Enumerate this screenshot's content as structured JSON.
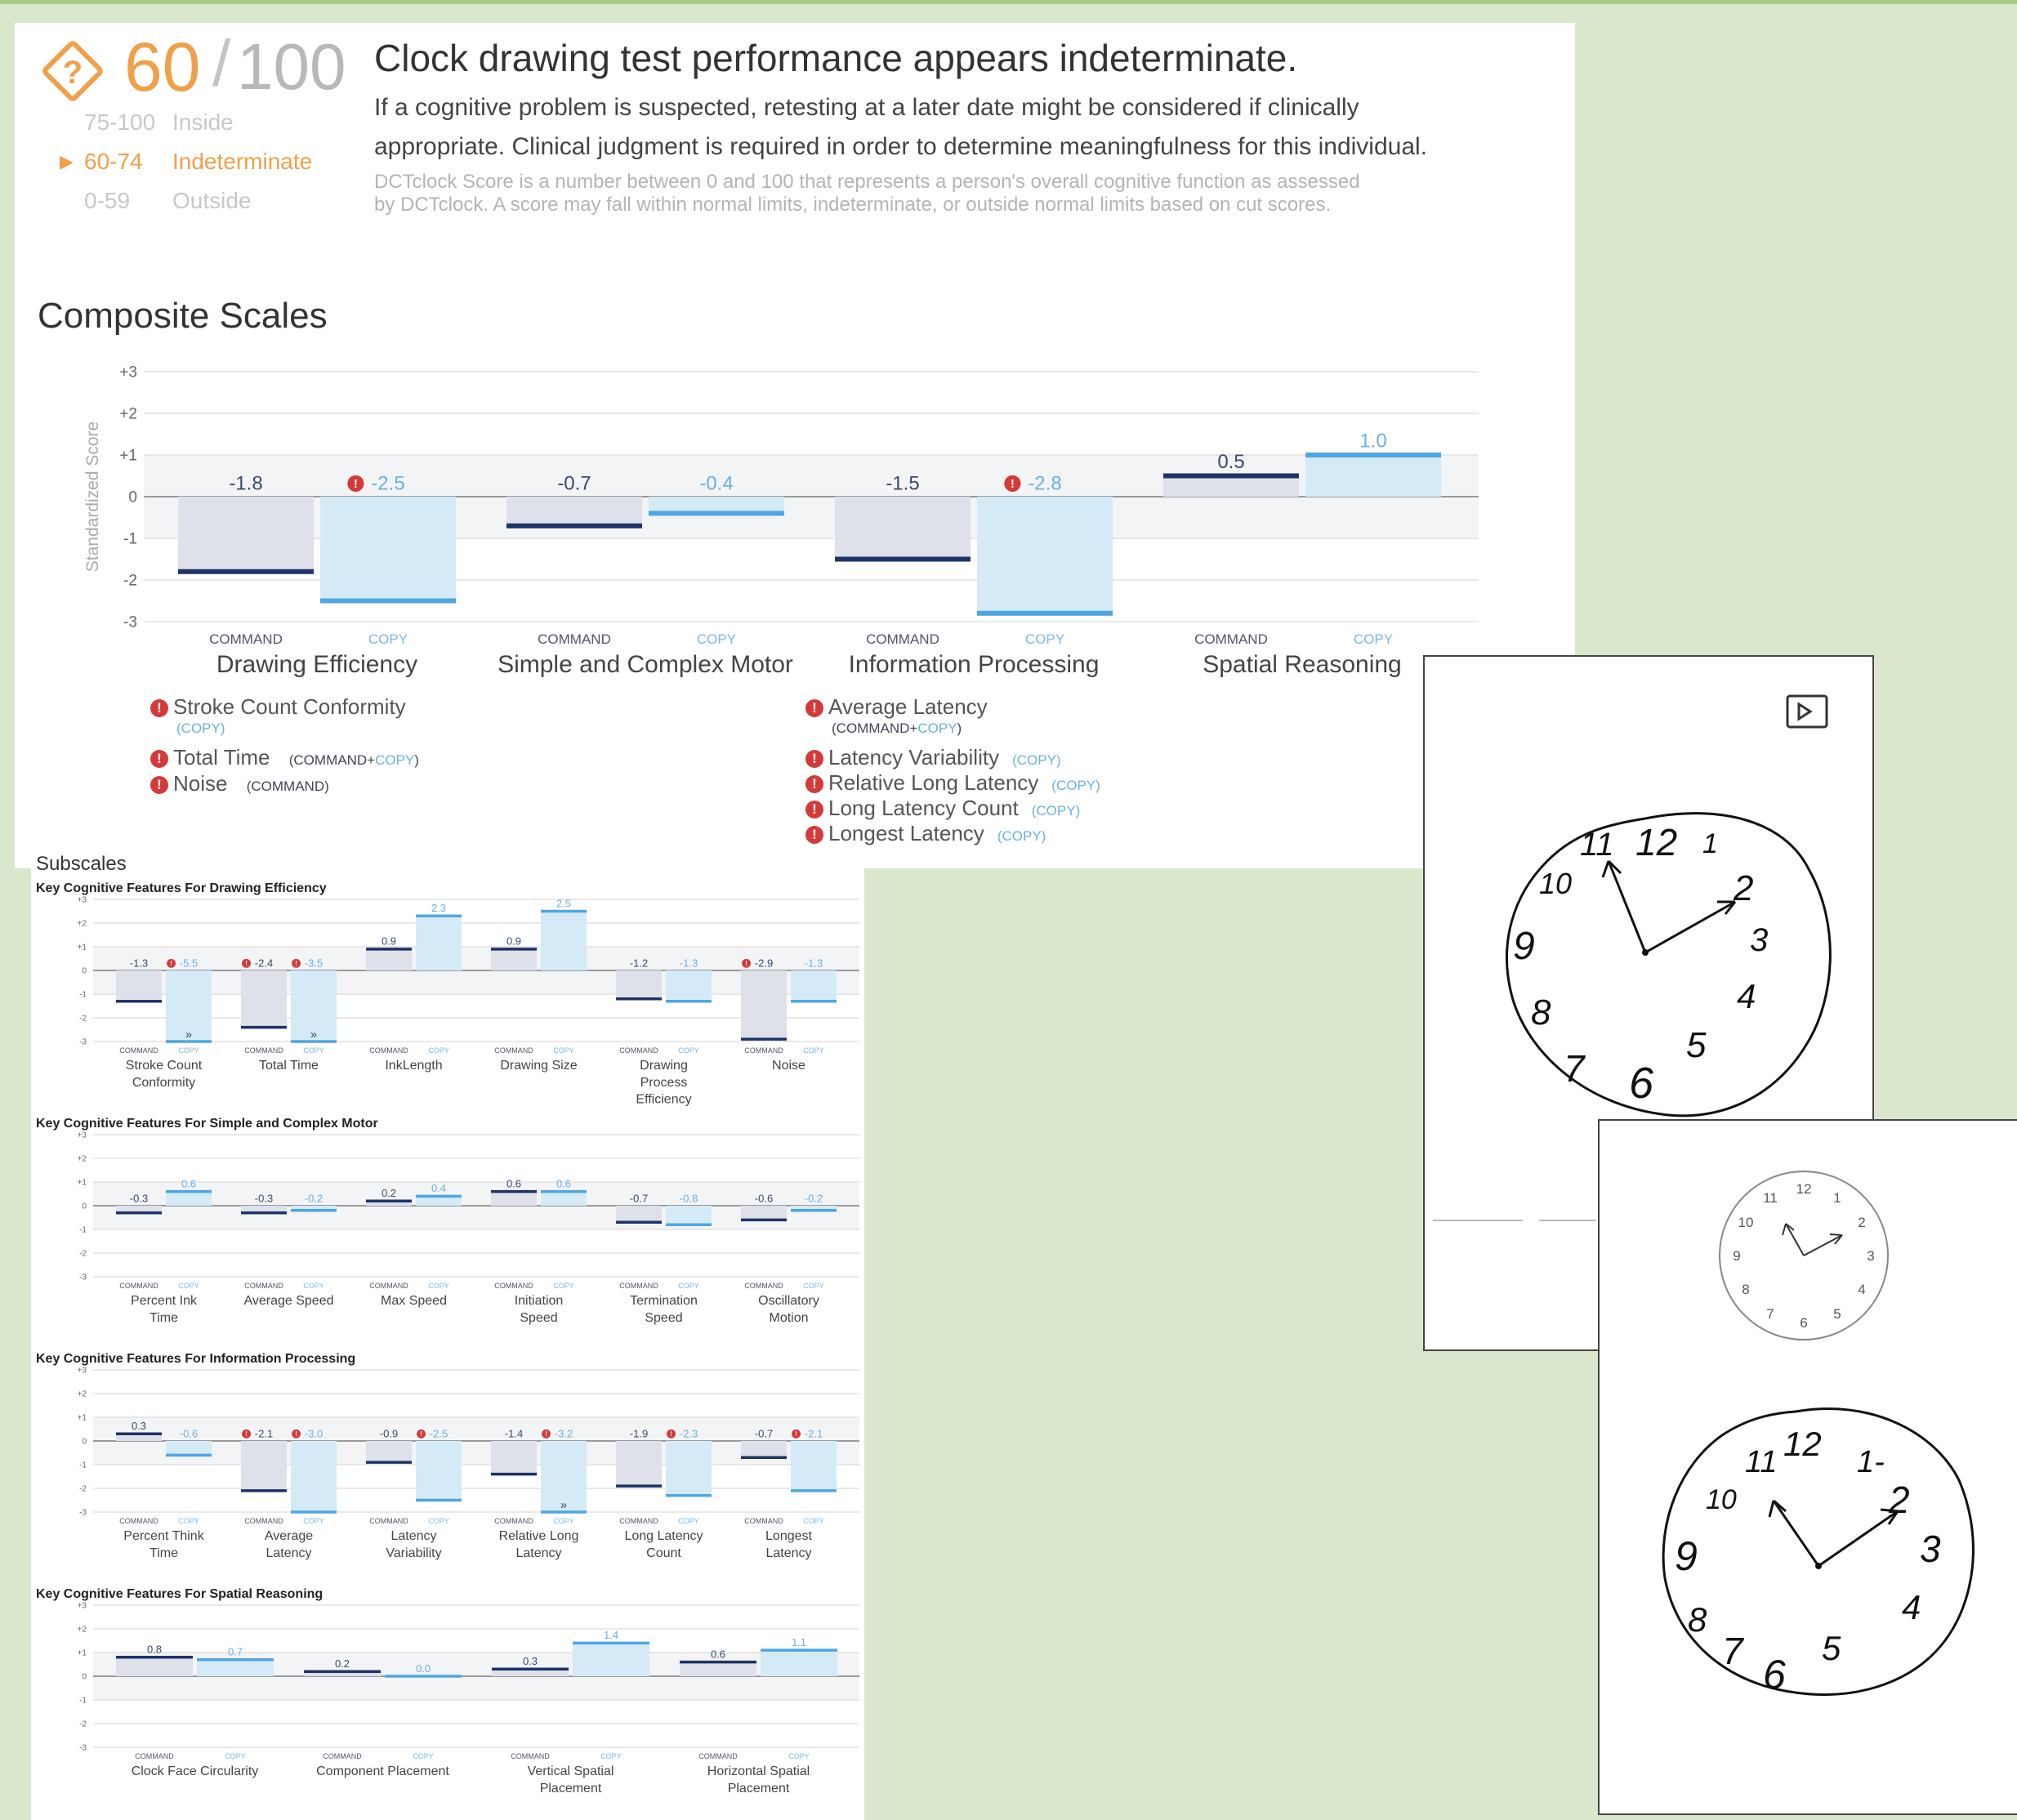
{
  "score": {
    "value": "60",
    "slash": "/",
    "max": "100",
    "ranges": [
      {
        "range": "75-100",
        "label": "Inside",
        "active": false
      },
      {
        "range": "60-74",
        "label": "Indeterminate",
        "active": true
      },
      {
        "range": "0-59",
        "label": "Outside",
        "active": false
      }
    ],
    "active_marker": "▶",
    "icon": "question-diamond-icon"
  },
  "headline": "Clock drawing test performance appears indeterminate.",
  "body_line1": "If a cognitive problem is suspected, retesting at a later date might be considered if clinically",
  "body_line2": "appropriate. Clinical judgment is required in order to determine meaningfulness for this individual.",
  "fine_line1": "DCTclock Score is a number between 0 and 100 that represents a person's overall cognitive function as assessed",
  "fine_line2": "by DCTclock. A score may fall within normal limits, indeterminate, or outside normal limits based on cut scores.",
  "composite_title": "Composite Scales",
  "tags": {
    "command": "COMMAND",
    "copy": "COPY",
    "command_copy_cmd": "COMMAND",
    "plus": "+"
  },
  "chart_data": [
    {
      "type": "bar",
      "title": "Composite Scales",
      "ylabel": "Standardized Score",
      "ylim": [
        -3,
        3
      ],
      "yticks": [
        "+3",
        "+2",
        "+1",
        "0",
        "-1",
        "-2",
        "-3"
      ],
      "categories": [
        "Drawing Efficiency",
        "Simple and Complex Motor",
        "Information Processing",
        "Spatial Reasoning"
      ],
      "series": [
        {
          "name": "COMMAND",
          "values": [
            -1.8,
            -0.7,
            -1.5,
            0.5
          ],
          "labels": [
            "-1.8",
            "-0.7",
            "-1.5",
            "0.5"
          ],
          "flags": [
            false,
            false,
            false,
            false
          ]
        },
        {
          "name": "COPY",
          "values": [
            -2.5,
            -0.4,
            -2.8,
            1.0
          ],
          "labels": [
            "-2.5",
            "-0.4",
            "-2.8",
            "1.0"
          ],
          "flags": [
            true,
            false,
            true,
            false
          ]
        }
      ],
      "colors": {
        "command": "#1e3366",
        "copy": "#4fa6e0"
      }
    },
    {
      "type": "bar",
      "title": "Key Cognitive Features For Drawing Efficiency",
      "ylim": [
        -3,
        3
      ],
      "categories": [
        "Stroke Count Conformity",
        "Total Time",
        "InkLength",
        "Drawing Size",
        "Drawing Process Efficiency",
        "Noise"
      ],
      "series": [
        {
          "name": "COMMAND",
          "values": [
            -1.3,
            -2.4,
            0.9,
            0.9,
            -1.2,
            -2.9
          ],
          "labels": [
            "-1.3",
            "-2.4",
            "0.9",
            "0.9",
            "-1.2",
            "-2.9"
          ],
          "flags": [
            false,
            true,
            false,
            false,
            false,
            true
          ]
        },
        {
          "name": "COPY",
          "values": [
            -5.5,
            -3.5,
            2.3,
            2.5,
            -1.3,
            -1.3
          ],
          "labels": [
            "-5.5",
            "-3.5",
            "2.3",
            "2.5",
            "-1.3",
            "-1.3"
          ],
          "flags": [
            true,
            true,
            false,
            false,
            false,
            false
          ]
        }
      ]
    },
    {
      "type": "bar",
      "title": "Key Cognitive Features For Simple and Complex Motor",
      "ylim": [
        -3,
        3
      ],
      "categories": [
        "Percent Ink Time",
        "Average Speed",
        "Max Speed",
        "Initiation Speed",
        "Termination Speed",
        "Oscillatory Motion"
      ],
      "series": [
        {
          "name": "COMMAND",
          "values": [
            -0.3,
            -0.3,
            0.2,
            0.6,
            -0.7,
            -0.6
          ],
          "labels": [
            "-0.3",
            "-0.3",
            "0.2",
            "0.6",
            "-0.7",
            "-0.6"
          ],
          "flags": [
            false,
            false,
            false,
            false,
            false,
            false
          ]
        },
        {
          "name": "COPY",
          "values": [
            0.6,
            -0.2,
            0.4,
            0.6,
            -0.8,
            -0.2
          ],
          "labels": [
            "0.6",
            "-0.2",
            "0.4",
            "0.6",
            "-0.8",
            "-0.2"
          ],
          "flags": [
            false,
            false,
            false,
            false,
            false,
            false
          ]
        }
      ]
    },
    {
      "type": "bar",
      "title": "Key Cognitive Features For Information Processing",
      "ylim": [
        -3,
        3
      ],
      "categories": [
        "Percent Think Time",
        "Average Latency",
        "Latency Variability",
        "Relative Long Latency",
        "Long Latency Count",
        "Longest Latency"
      ],
      "series": [
        {
          "name": "COMMAND",
          "values": [
            0.3,
            -2.1,
            -0.9,
            -1.4,
            -1.9,
            -0.7
          ],
          "labels": [
            "0.3",
            "-2.1",
            "-0.9",
            "-1.4",
            "-1.9",
            "-0.7"
          ],
          "flags": [
            false,
            true,
            false,
            false,
            false,
            false
          ]
        },
        {
          "name": "COPY",
          "values": [
            -0.6,
            -3.0,
            -2.5,
            -3.2,
            -2.3,
            -2.1
          ],
          "labels": [
            "-0.6",
            "-3.0",
            "-2.5",
            "-3.2",
            "-2.3",
            "-2.1"
          ],
          "flags": [
            false,
            true,
            true,
            true,
            true,
            true
          ]
        }
      ]
    },
    {
      "type": "bar",
      "title": "Key Cognitive Features For Spatial Reasoning",
      "ylim": [
        -3,
        3
      ],
      "categories": [
        "Clock Face Circularity",
        "Component Placement",
        "Vertical Spatial Placement",
        "Horizontal Spatial Placement"
      ],
      "series": [
        {
          "name": "COMMAND",
          "values": [
            0.8,
            0.2,
            0.3,
            0.6
          ],
          "labels": [
            "0.8",
            "0.2",
            "0.3",
            "0.6"
          ],
          "flags": [
            false,
            false,
            false,
            false
          ]
        },
        {
          "name": "COPY",
          "values": [
            0.7,
            0.0,
            1.4,
            1.1
          ],
          "labels": [
            "0.7",
            "0.0",
            "1.4",
            "1.1"
          ],
          "flags": [
            false,
            false,
            false,
            false
          ]
        }
      ]
    }
  ],
  "composite_flags": {
    "left": [
      {
        "label": "Stroke Count Conformity",
        "tag_cmd": "",
        "tag_copy": "COPY"
      },
      {
        "label": "Total Time",
        "tag_cmd": "COMMAND",
        "tag_copy": "COPY"
      },
      {
        "label": "Noise",
        "tag_cmd": "COMMAND",
        "tag_copy": ""
      }
    ],
    "right": [
      {
        "label": "Average Latency",
        "tag_cmd": "COMMAND",
        "tag_copy": "COPY"
      },
      {
        "label": "Latency Variability",
        "tag_cmd": "",
        "tag_copy": "COPY"
      },
      {
        "label": "Relative Long Latency",
        "tag_cmd": "",
        "tag_copy": "COPY"
      },
      {
        "label": "Long Latency Count",
        "tag_cmd": "",
        "tag_copy": "COPY"
      },
      {
        "label": "Longest Latency",
        "tag_cmd": "",
        "tag_copy": "COPY"
      }
    ]
  },
  "subscales_title": "Subscales",
  "clock_card_icon": "export-icon",
  "template_clock_numbers": [
    "12",
    "1",
    "2",
    "3",
    "4",
    "5",
    "6",
    "7",
    "8",
    "9",
    "10",
    "11"
  ]
}
